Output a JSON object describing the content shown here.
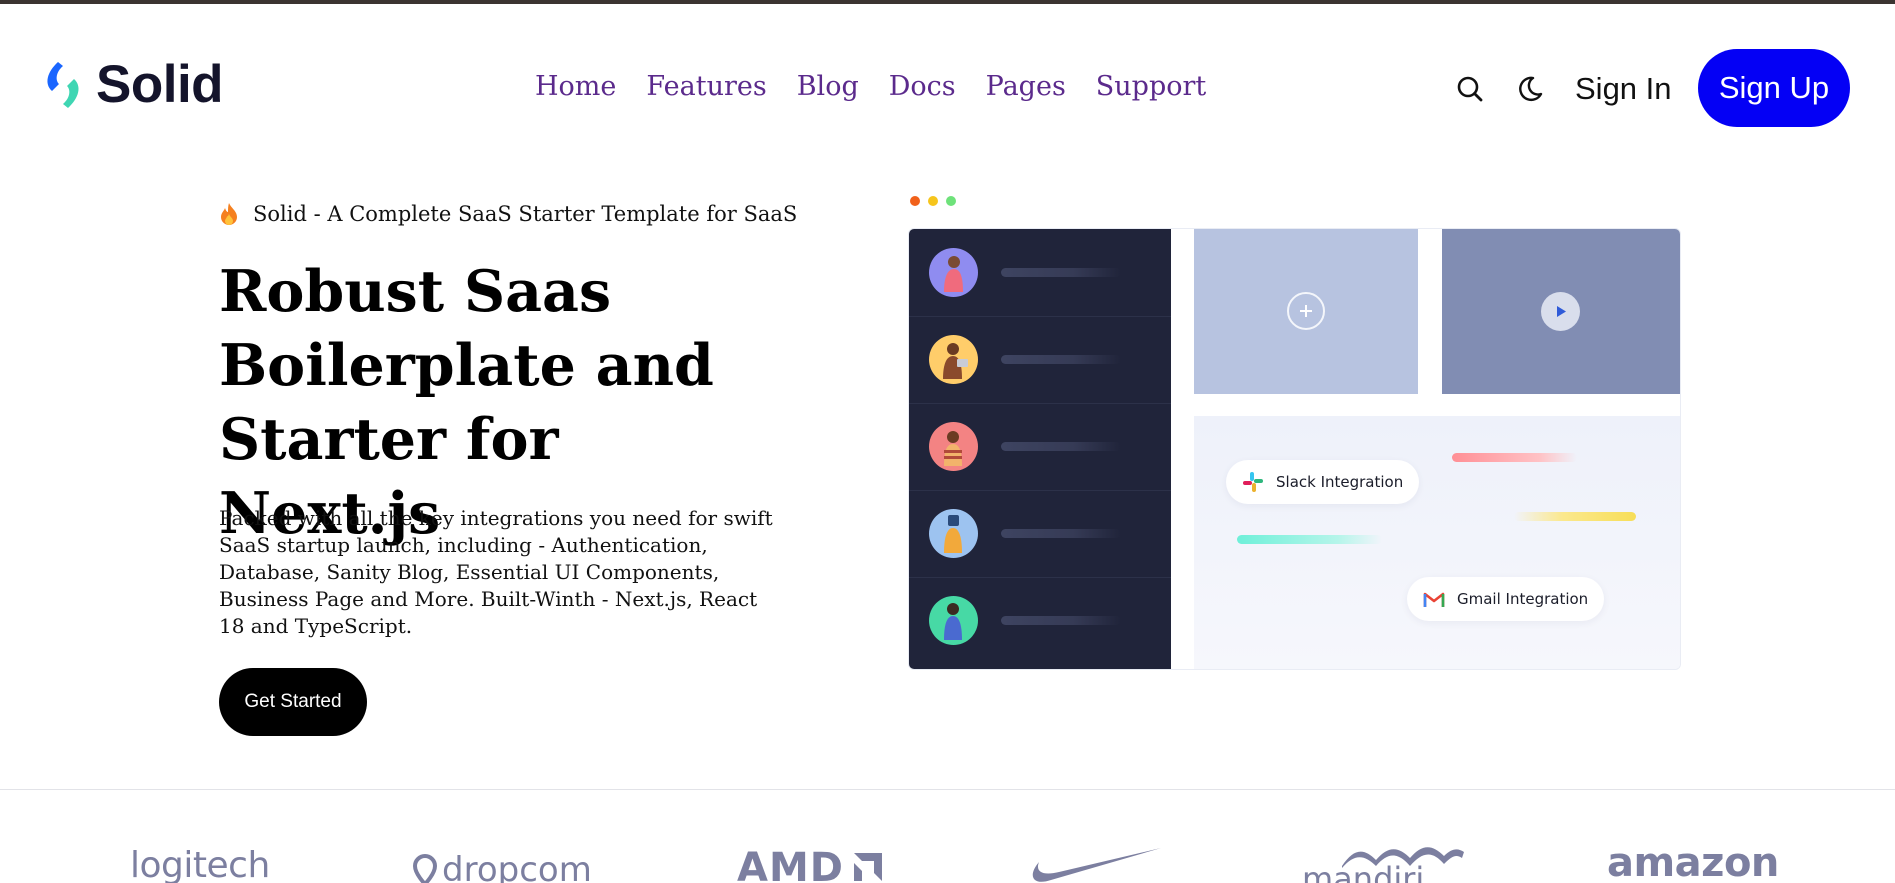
{
  "header": {
    "brand": "Solid",
    "nav": [
      "Home",
      "Features",
      "Blog",
      "Docs",
      "Pages",
      "Support"
    ],
    "sign_in": "Sign In",
    "sign_up": "Sign Up",
    "icons": {
      "search": "search-icon",
      "theme": "moon-icon"
    }
  },
  "hero": {
    "badge_icon": "fire-icon",
    "badge": "Solid - A Complete SaaS Starter Template for SaaS",
    "title": "Robust Saas Boilerplate and Starter for Next.js",
    "description": "Packed with all the key integrations you need for swift SaaS startup launch, including - Authentication, Database, Sanity Blog, Essential UI Components, Business Page and More. Built-Winth - Next.js, React 18 and TypeScript.",
    "cta": "Get Started"
  },
  "mockup": {
    "integrations": [
      {
        "label": "Slack Integration",
        "icon": "slack-icon"
      },
      {
        "label": "Gmail Integration",
        "icon": "gmail-icon"
      }
    ]
  },
  "brands": [
    "logitech",
    "dropcom",
    "AMD",
    "Nike",
    "mandiri",
    "amazon"
  ],
  "colors": {
    "primary": "#0400f5",
    "nav_link": "#5b2a8c",
    "sidebar": "#20243a",
    "brand_logos": "#7c7fa0"
  }
}
